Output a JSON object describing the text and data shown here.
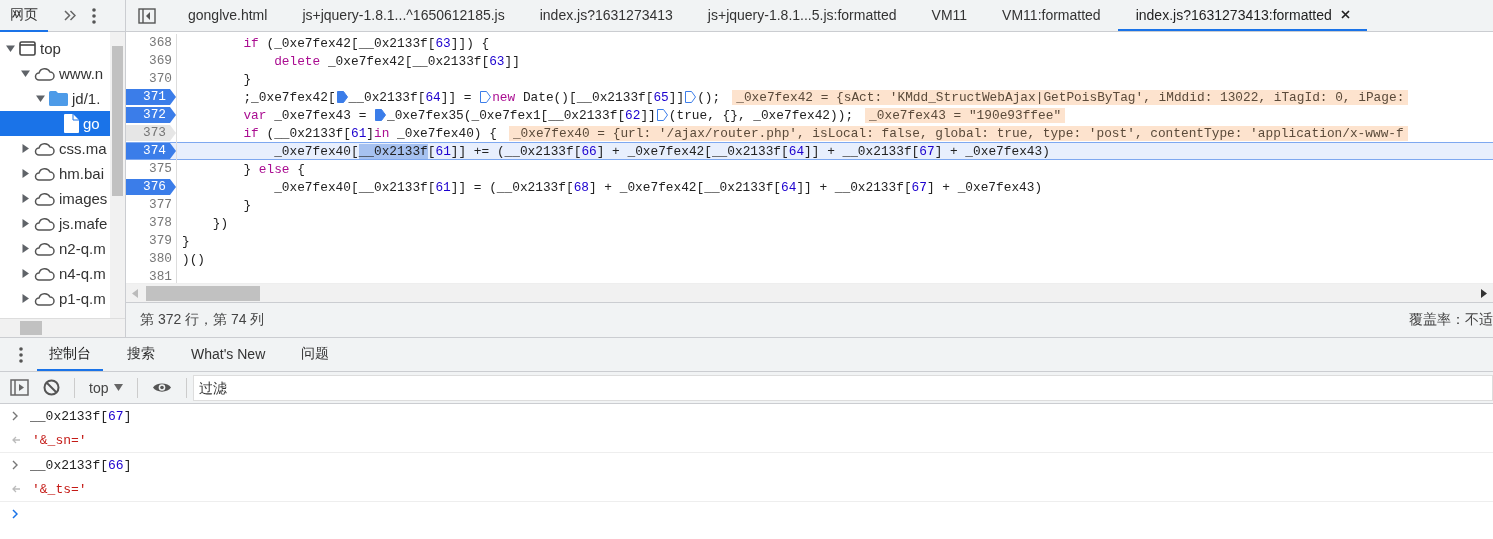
{
  "sidebar": {
    "tab": "网页",
    "tree": [
      {
        "label": "top",
        "kind": "frame",
        "expanded": true,
        "selected": false,
        "children": [
          {
            "label": "www.n",
            "kind": "domain",
            "expanded": true,
            "selected": false,
            "children": [
              {
                "label": "jd/1.",
                "kind": "folder",
                "expanded": true,
                "selected": false,
                "children": [
                  {
                    "label": "go",
                    "kind": "file",
                    "selected": true
                  }
                ]
              }
            ]
          },
          {
            "label": "css.ma",
            "kind": "domain",
            "expanded": false,
            "selected": false
          },
          {
            "label": "hm.bai",
            "kind": "domain",
            "expanded": false,
            "selected": false
          },
          {
            "label": "images",
            "kind": "domain",
            "expanded": false,
            "selected": false
          },
          {
            "label": "js.mafe",
            "kind": "domain",
            "expanded": false,
            "selected": false
          },
          {
            "label": "n2-q.m",
            "kind": "domain",
            "expanded": false,
            "selected": false
          },
          {
            "label": "n4-q.m",
            "kind": "domain",
            "expanded": false,
            "selected": false
          },
          {
            "label": "p1-q.m",
            "kind": "domain",
            "expanded": false,
            "selected": false
          }
        ]
      }
    ]
  },
  "editor_tabs": [
    {
      "label": "gonglve.html",
      "selected": false
    },
    {
      "label": "js+jquery-1.8.1...^1650612185.js",
      "selected": false
    },
    {
      "label": "index.js?1631273413",
      "selected": false
    },
    {
      "label": "js+jquery-1.8.1...5.js:formatted",
      "selected": false
    },
    {
      "label": "VM11",
      "selected": false
    },
    {
      "label": "VM11:formatted",
      "selected": false
    },
    {
      "label": "index.js?1631273413:formatted",
      "selected": true
    }
  ],
  "code_lines": [
    {
      "number": "368",
      "breakpoint": false,
      "hovered": false,
      "current": false,
      "tokens": [
        {
          "t": "        if",
          "kind": "keyword"
        },
        {
          "t": " (_0xe7fex42[__0x2133f["
        },
        {
          "t": "63",
          "kind": "number"
        },
        {
          "t": "]]) {"
        }
      ]
    },
    {
      "number": "369",
      "breakpoint": false,
      "hovered": false,
      "current": false,
      "tokens": [
        {
          "t": "            delete",
          "kind": "keyword"
        },
        {
          "t": " _0xe7fex42[__0x2133f["
        },
        {
          "t": "63",
          "kind": "number"
        },
        {
          "t": "]]"
        }
      ]
    },
    {
      "number": "370",
      "breakpoint": false,
      "hovered": false,
      "current": false,
      "tokens": [
        {
          "t": "        }"
        }
      ]
    },
    {
      "number": "371",
      "breakpoint": true,
      "hovered": false,
      "current": false,
      "tokens": [
        {
          "t": "        ;_0xe7fex42["
        },
        {
          "kind": "marker",
          "filled": true
        },
        {
          "t": "__0x2133f["
        },
        {
          "t": "64",
          "kind": "number"
        },
        {
          "t": "]] = "
        },
        {
          "kind": "marker",
          "filled": false
        },
        {
          "t": "new",
          "kind": "keyword"
        },
        {
          "t": " Date()[__0x2133f["
        },
        {
          "t": "65",
          "kind": "number"
        },
        {
          "t": "]]"
        },
        {
          "kind": "marker",
          "filled": false
        },
        {
          "t": "();"
        }
      ],
      "inline_value": "_0xe7fex42 = {sAct: 'KMdd_StructWebAjax|GetPoisByTag', iMddid: 13022, iTagId: 0, iPage:"
    },
    {
      "number": "372",
      "breakpoint": true,
      "hovered": false,
      "current": false,
      "tokens": [
        {
          "t": "        var",
          "kind": "keyword"
        },
        {
          "t": " _0xe7fex43 = "
        },
        {
          "kind": "marker",
          "filled": true
        },
        {
          "t": "_0xe7fex35(_0xe7fex1[__0x2133f["
        },
        {
          "t": "62",
          "kind": "number"
        },
        {
          "t": "]]"
        },
        {
          "kind": "marker",
          "filled": false
        },
        {
          "t": "(true, {}, _0xe7fex42));"
        }
      ],
      "inline_value": "_0xe7fex43 = \"190e93ffee\""
    },
    {
      "number": "373",
      "breakpoint": false,
      "hovered": true,
      "current": false,
      "tokens": [
        {
          "t": "        if",
          "kind": "keyword"
        },
        {
          "t": " (__0x2133f["
        },
        {
          "t": "61",
          "kind": "number"
        },
        {
          "t": "]"
        },
        {
          "t": "in",
          "kind": "keyword"
        },
        {
          "t": " _0xe7fex40) {"
        }
      ],
      "inline_value": "_0xe7fex40 = {url: '/ajax/router.php', isLocal: false, global: true, type: 'post', contentType: 'application/x-www-f"
    },
    {
      "number": "374",
      "breakpoint": true,
      "hovered": false,
      "current": true,
      "tokens": [
        {
          "t": "            _0xe7fex40["
        },
        {
          "t": "__0x2133f",
          "kind": "selection"
        },
        {
          "t": "["
        },
        {
          "t": "61",
          "kind": "number"
        },
        {
          "t": "]] += (__0x2133f["
        },
        {
          "t": "66",
          "kind": "number"
        },
        {
          "t": "] + _0xe7fex42[__0x2133f["
        },
        {
          "t": "64",
          "kind": "number"
        },
        {
          "t": "]] + __0x2133f["
        },
        {
          "t": "67",
          "kind": "number"
        },
        {
          "t": "] + _0xe7fex43)"
        }
      ]
    },
    {
      "number": "375",
      "breakpoint": false,
      "hovered": false,
      "current": false,
      "tokens": [
        {
          "t": "        } "
        },
        {
          "t": "else",
          "kind": "keyword"
        },
        {
          "t": " {"
        }
      ]
    },
    {
      "number": "376",
      "breakpoint": true,
      "hovered": false,
      "current": false,
      "tokens": [
        {
          "t": "            _0xe7fex40[__0x2133f["
        },
        {
          "t": "61",
          "kind": "number"
        },
        {
          "t": "]] = (__0x2133f["
        },
        {
          "t": "68",
          "kind": "number"
        },
        {
          "t": "] + _0xe7fex42[__0x2133f["
        },
        {
          "t": "64",
          "kind": "number"
        },
        {
          "t": "]] + __0x2133f["
        },
        {
          "t": "67",
          "kind": "number"
        },
        {
          "t": "] + _0xe7fex43)"
        }
      ]
    },
    {
      "number": "377",
      "breakpoint": false,
      "hovered": false,
      "current": false,
      "tokens": [
        {
          "t": "        }"
        }
      ]
    },
    {
      "number": "378",
      "breakpoint": false,
      "hovered": false,
      "current": false,
      "tokens": [
        {
          "t": "    })"
        }
      ]
    },
    {
      "number": "379",
      "breakpoint": false,
      "hovered": false,
      "current": false,
      "tokens": [
        {
          "t": "}"
        }
      ]
    },
    {
      "number": "380",
      "breakpoint": false,
      "hovered": false,
      "current": false,
      "tokens": [
        {
          "t": ")()"
        }
      ]
    },
    {
      "number": "381",
      "breakpoint": false,
      "hovered": false,
      "current": false
    }
  ],
  "status_bar": {
    "position": "第 372 行，第 74 列",
    "coverage": "覆盖率：不适"
  },
  "drawer_tabs": [
    {
      "label": "控制台",
      "selected": true
    },
    {
      "label": "搜索",
      "selected": false
    },
    {
      "label": "What's New",
      "selected": false
    },
    {
      "label": "问题",
      "selected": false
    }
  ],
  "console_toolbar": {
    "context": "top",
    "filter_placeholder": "过滤"
  },
  "console_entries": [
    {
      "kind": "input",
      "tokens": [
        {
          "t": "__0x2133f["
        },
        {
          "t": "67",
          "kind": "number"
        },
        {
          "t": "]"
        }
      ]
    },
    {
      "kind": "output",
      "tokens": [
        {
          "t": "'&_sn='",
          "kind": "string"
        }
      ]
    },
    {
      "kind": "input",
      "tokens": [
        {
          "t": "__0x2133f["
        },
        {
          "t": "66",
          "kind": "number"
        },
        {
          "t": "]"
        }
      ]
    },
    {
      "kind": "output",
      "tokens": [
        {
          "t": "'&_ts='",
          "kind": "string"
        }
      ]
    },
    {
      "kind": "prompt"
    }
  ]
}
